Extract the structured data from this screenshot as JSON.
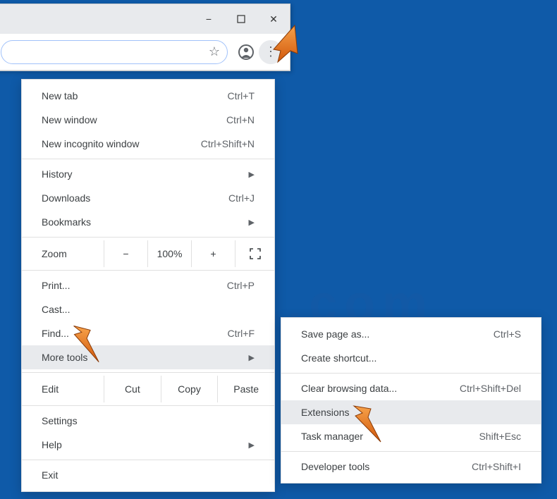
{
  "window": {
    "minimize_icon": "−",
    "maximize_icon": "☐",
    "close_icon": "✕"
  },
  "toolbar": {
    "star_icon": "☆",
    "profile_icon": "◯",
    "menu_icon": "⋮"
  },
  "menu": {
    "new_tab": "New tab",
    "new_tab_sc": "Ctrl+T",
    "new_window": "New window",
    "new_window_sc": "Ctrl+N",
    "new_incognito": "New incognito window",
    "new_incognito_sc": "Ctrl+Shift+N",
    "history": "History",
    "downloads": "Downloads",
    "downloads_sc": "Ctrl+J",
    "bookmarks": "Bookmarks",
    "zoom_label": "Zoom",
    "zoom_minus": "−",
    "zoom_value": "100%",
    "zoom_plus": "+",
    "print": "Print...",
    "print_sc": "Ctrl+P",
    "cast": "Cast...",
    "find": "Find...",
    "find_sc": "Ctrl+F",
    "more_tools": "More tools",
    "edit_label": "Edit",
    "cut": "Cut",
    "copy": "Copy",
    "paste": "Paste",
    "settings": "Settings",
    "help": "Help",
    "exit": "Exit"
  },
  "submenu": {
    "save_page": "Save page as...",
    "save_page_sc": "Ctrl+S",
    "create_shortcut": "Create shortcut...",
    "clear_data": "Clear browsing data...",
    "clear_data_sc": "Ctrl+Shift+Del",
    "extensions": "Extensions",
    "task_manager": "Task manager",
    "task_manager_sc": "Shift+Esc",
    "developer_tools": "Developer tools",
    "developer_tools_sc": "Ctrl+Shift+I"
  },
  "watermark": {
    "big": "PC",
    "sub": "risk.com"
  }
}
